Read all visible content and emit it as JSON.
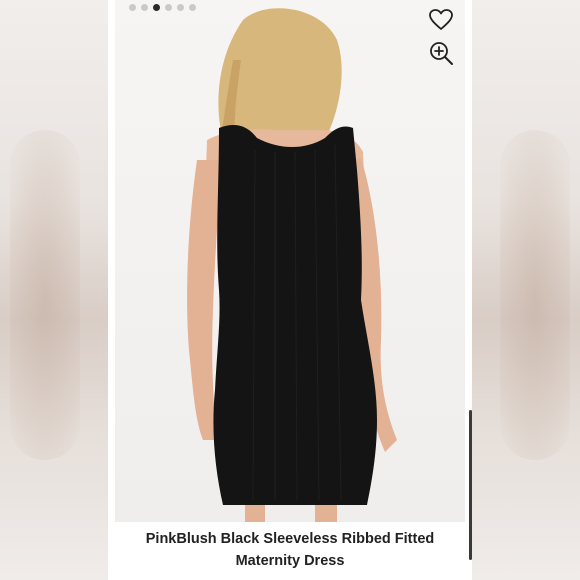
{
  "carousel": {
    "total": 6,
    "active_index": 2
  },
  "icons": {
    "favorite": "heart-icon",
    "zoom": "zoom-in-icon"
  },
  "product": {
    "title_line1": "PinkBlush Black Sleeveless Ribbed Fitted",
    "title_line2": "Maternity Dress"
  },
  "colors": {
    "dress": "#141414",
    "dot_active": "#2a2a2a",
    "dot_inactive": "#c9c9c9"
  }
}
